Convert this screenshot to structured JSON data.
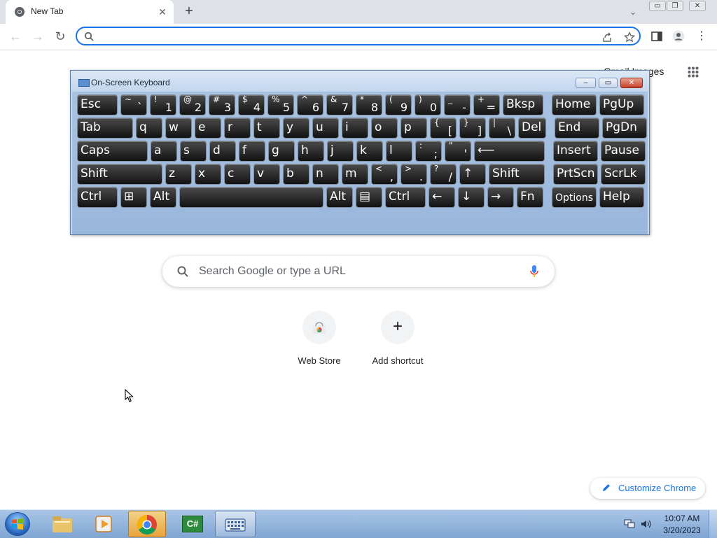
{
  "browser": {
    "tab_title": "New Tab",
    "tab_close": "✕",
    "new_tab": "+",
    "window_controls": [
      "▭",
      "❐",
      "✕"
    ]
  },
  "toolbar": {
    "back": "←",
    "forward": "→",
    "reload": "↻",
    "omnibox_value": ""
  },
  "ntp": {
    "top_link": "Gmail  Images",
    "search_placeholder": "Search Google or type a URL",
    "shortcuts": [
      {
        "label": "Web Store",
        "icon": "web-store-icon"
      },
      {
        "label": "Add shortcut",
        "icon": "plus-icon",
        "glyph": "+"
      }
    ],
    "customize_label": "Customize Chrome"
  },
  "osk": {
    "title": "On-Screen Keyboard",
    "controls": [
      "–",
      "▭",
      "✕"
    ],
    "rows": [
      [
        {
          "main": "Esc"
        },
        {
          "shift": "~",
          "base": "`"
        },
        {
          "shift": "!",
          "base": "1"
        },
        {
          "shift": "@",
          "base": "2"
        },
        {
          "shift": "#",
          "base": "3"
        },
        {
          "shift": "$",
          "base": "4"
        },
        {
          "shift": "%",
          "base": "5"
        },
        {
          "shift": "^",
          "base": "6"
        },
        {
          "shift": "&",
          "base": "7"
        },
        {
          "shift": "*",
          "base": "8"
        },
        {
          "shift": "(",
          "base": "9"
        },
        {
          "shift": ")",
          "base": "0"
        },
        {
          "shift": "_",
          "base": "-"
        },
        {
          "shift": "+",
          "base": "="
        },
        {
          "main": "Bksp"
        },
        {
          "main": "Home"
        },
        {
          "main": "PgUp"
        }
      ],
      [
        {
          "main": "Tab"
        },
        {
          "main": "q"
        },
        {
          "main": "w"
        },
        {
          "main": "e"
        },
        {
          "main": "r"
        },
        {
          "main": "t"
        },
        {
          "main": "y"
        },
        {
          "main": "u"
        },
        {
          "main": "i"
        },
        {
          "main": "o"
        },
        {
          "main": "p"
        },
        {
          "shift": "{",
          "base": "["
        },
        {
          "shift": "}",
          "base": "]"
        },
        {
          "shift": "|",
          "base": "\\"
        },
        {
          "main": "Del"
        },
        {
          "main": "End"
        },
        {
          "main": "PgDn"
        }
      ],
      [
        {
          "main": "Caps"
        },
        {
          "main": "a"
        },
        {
          "main": "s"
        },
        {
          "main": "d"
        },
        {
          "main": "f"
        },
        {
          "main": "g"
        },
        {
          "main": "h"
        },
        {
          "main": "j"
        },
        {
          "main": "k"
        },
        {
          "main": "l"
        },
        {
          "shift": ":",
          "base": ";"
        },
        {
          "shift": "\"",
          "base": "'"
        },
        {
          "main": "⟵"
        },
        {
          "main": "Insert"
        },
        {
          "main": "Pause"
        }
      ],
      [
        {
          "main": "Shift"
        },
        {
          "main": "z"
        },
        {
          "main": "x"
        },
        {
          "main": "c"
        },
        {
          "main": "v"
        },
        {
          "main": "b"
        },
        {
          "main": "n"
        },
        {
          "main": "m"
        },
        {
          "shift": "<",
          "base": ","
        },
        {
          "shift": ">",
          "base": "."
        },
        {
          "shift": "?",
          "base": "/"
        },
        {
          "main": "↑"
        },
        {
          "main": "Shift"
        },
        {
          "main": "PrtScn"
        },
        {
          "main": "ScrLk"
        }
      ],
      [
        {
          "main": "Ctrl"
        },
        {
          "main": "⊞"
        },
        {
          "main": "Alt"
        },
        {
          "main": ""
        },
        {
          "main": "Alt"
        },
        {
          "main": "▤"
        },
        {
          "main": "Ctrl"
        },
        {
          "main": "←"
        },
        {
          "main": "↓"
        },
        {
          "main": "→"
        },
        {
          "main": "Fn"
        },
        {
          "main": "Options"
        },
        {
          "main": "Help"
        }
      ]
    ]
  },
  "taskbar": {
    "apps": [
      {
        "name": "windows-explorer",
        "icon": "folder-icon"
      },
      {
        "name": "media-player",
        "icon": "media-player-icon"
      },
      {
        "name": "google-chrome",
        "icon": "chrome-icon"
      },
      {
        "name": "csharp-editor",
        "icon": "csharp-icon",
        "glyph": "C#"
      },
      {
        "name": "on-screen-keyboard",
        "icon": "keyboard-icon"
      }
    ],
    "time": "10:07 AM",
    "date": "3/20/2023"
  },
  "colors": {
    "accent": "#1a73e8",
    "osk_frame": "#c7d9ef",
    "osk_key": "#1e1e1e",
    "taskbar": "#8fb2da"
  }
}
